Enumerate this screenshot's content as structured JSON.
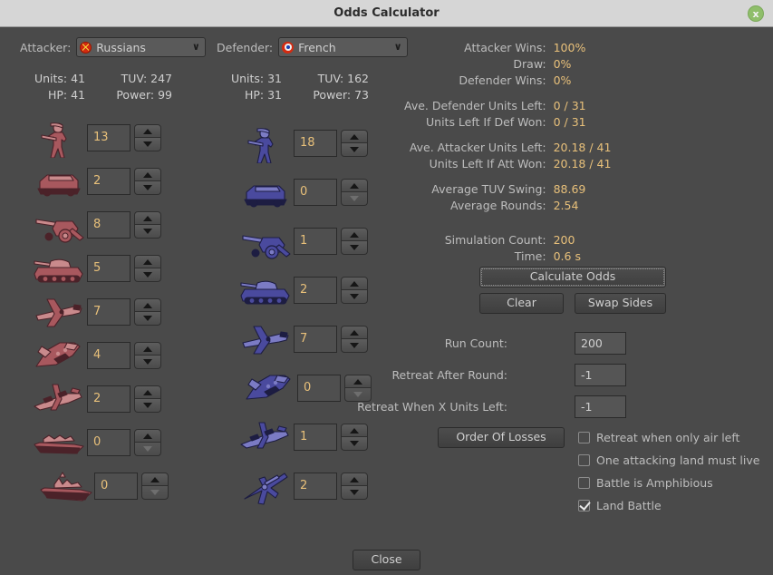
{
  "window": {
    "title": "Odds Calculator",
    "close_icon": "close-circle-icon",
    "close_glyph": "x"
  },
  "attacker": {
    "label": "Attacker:",
    "selected": "Russians",
    "flag_icon": "russians-flag-icon",
    "dropdown_glyph": "∨",
    "stats": {
      "units_label": "Units: 41",
      "tuv_label": "TUV: 247",
      "hp_label": "HP: 41",
      "power_label": "Power: 99"
    },
    "units": [
      {
        "icon": "infantry-icon",
        "value": "13",
        "down_enabled": true
      },
      {
        "icon": "mech-infantry-icon",
        "value": "2",
        "down_enabled": true
      },
      {
        "icon": "artillery-icon",
        "value": "8",
        "down_enabled": true
      },
      {
        "icon": "tank-icon",
        "value": "5",
        "down_enabled": true
      },
      {
        "icon": "fighter-icon",
        "value": "7",
        "down_enabled": true
      },
      {
        "icon": "tactical-bomber-icon",
        "value": "4",
        "down_enabled": true
      },
      {
        "icon": "strategic-bomber-icon",
        "value": "2",
        "down_enabled": true
      },
      {
        "icon": "transport-icon",
        "value": "0",
        "down_enabled": false
      },
      {
        "icon": "battleship-icon",
        "value": "0",
        "down_enabled": false
      }
    ]
  },
  "defender": {
    "label": "Defender:",
    "selected": "French",
    "flag_icon": "french-roundel-icon",
    "dropdown_glyph": "∨",
    "stats": {
      "units_label": "Units: 31",
      "tuv_label": "TUV: 162",
      "hp_label": "HP: 31",
      "power_label": "Power: 73"
    },
    "units": [
      {
        "icon": "infantry-icon",
        "value": "18",
        "down_enabled": true
      },
      {
        "icon": "mech-infantry-icon",
        "value": "0",
        "down_enabled": false
      },
      {
        "icon": "artillery-icon",
        "value": "1",
        "down_enabled": true
      },
      {
        "icon": "tank-icon",
        "value": "2",
        "down_enabled": true
      },
      {
        "icon": "fighter-icon",
        "value": "7",
        "down_enabled": true
      },
      {
        "icon": "tactical-bomber-icon",
        "value": "0",
        "down_enabled": false
      },
      {
        "icon": "strategic-bomber-icon",
        "value": "1",
        "down_enabled": true
      },
      {
        "icon": "aa-gun-icon",
        "value": "2",
        "down_enabled": true
      }
    ]
  },
  "results": {
    "rows": [
      {
        "key": "Attacker Wins:",
        "value": "100%"
      },
      {
        "key": "Draw:",
        "value": "0%"
      },
      {
        "key": "Defender Wins:",
        "value": "0%"
      },
      {
        "key": "Ave. Defender Units Left:",
        "value": "0 / 31"
      },
      {
        "key": "Units Left If Def Won:",
        "value": "0 / 31"
      },
      {
        "key": "Ave. Attacker Units Left:",
        "value": "20.18 / 41"
      },
      {
        "key": "Units Left If Att Won:",
        "value": "20.18 / 41"
      },
      {
        "key": "Average TUV Swing:",
        "value": "88.69"
      },
      {
        "key": "Average Rounds:",
        "value": "2.54"
      },
      {
        "key": "Simulation Count:",
        "value": "200"
      },
      {
        "key": "Time:",
        "value": "0.6 s"
      }
    ]
  },
  "actions": {
    "calculate_odds": "Calculate Odds",
    "clear": "Clear",
    "swap_sides": "Swap Sides",
    "order_of_losses": "Order Of Losses",
    "close": "Close"
  },
  "settings": {
    "run_count_label": "Run Count:",
    "run_count_value": "200",
    "retreat_after_round_label": "Retreat After Round:",
    "retreat_after_round_value": "-1",
    "retreat_units_left_label": "Retreat When X Units Left:",
    "retreat_units_left_value": "-1",
    "checkboxes": [
      {
        "label": "Retreat when only air left",
        "checked": false
      },
      {
        "label": "One attacking land must live",
        "checked": false
      },
      {
        "label": "Battle is Amphibious",
        "checked": false
      },
      {
        "label": "Land Battle",
        "checked": true
      }
    ]
  },
  "colors": {
    "background": "#4a4a4a",
    "titlebar": "#d6d6d6",
    "value_text": "#e8c07a",
    "label_text": "#bdbdbd",
    "attacker_unit": "#b05f63",
    "defender_unit": "#4a4a9c",
    "close_button": "#8fbe6a"
  }
}
